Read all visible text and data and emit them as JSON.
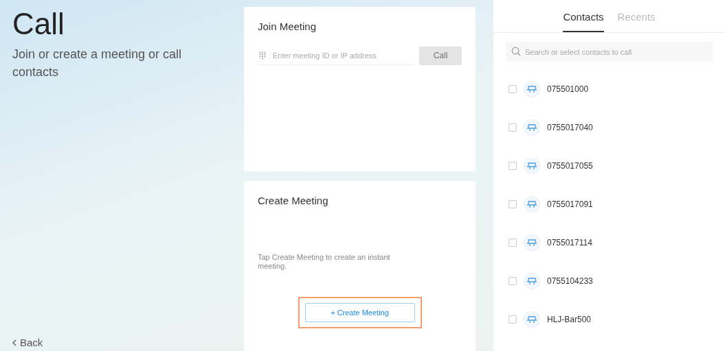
{
  "header": {
    "title": "Call",
    "subtitle": "Join or create a meeting or call contacts",
    "back": "Back"
  },
  "join": {
    "title": "Join Meeting",
    "placeholder": "Enter meeting ID or IP address",
    "button": "Call",
    "button_disabled": true
  },
  "create": {
    "title": "Create Meeting",
    "hint": "Tap Create Meeting to create an instant meeting.",
    "button": "Create Meeting",
    "button_icon": "+",
    "highlighted": true
  },
  "tabs": [
    {
      "label": "Contacts",
      "selected": true
    },
    {
      "label": "Recents",
      "selected": false
    }
  ],
  "search": {
    "placeholder": "Search or select contacts to call"
  },
  "contacts": [
    {
      "name": "075501000",
      "checked": false
    },
    {
      "name": "0755017040",
      "checked": false
    },
    {
      "name": "0755017055",
      "checked": false
    },
    {
      "name": "0755017091",
      "checked": false
    },
    {
      "name": "0755017114",
      "checked": false
    },
    {
      "name": "0755104233",
      "checked": false
    },
    {
      "name": "HLJ-Bar500",
      "checked": false
    }
  ]
}
